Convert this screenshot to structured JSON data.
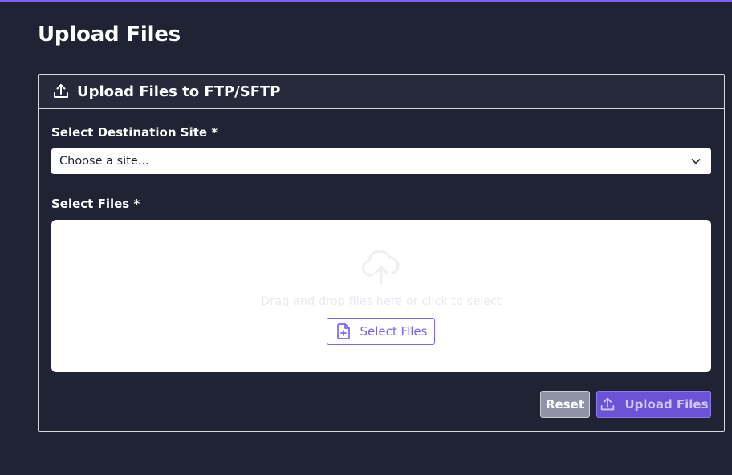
{
  "page": {
    "title": "Upload Files",
    "accent_color": "#7b61ff",
    "background_color": "#1f2333"
  },
  "card": {
    "icon": "upload-icon",
    "title": "Upload Files to FTP/SFTP"
  },
  "form": {
    "site_label": "Select Destination Site *",
    "site_select": {
      "selected": "Choose a site...",
      "icon": "chevron-down-icon"
    },
    "files_label": "Select Files *",
    "dropzone": {
      "icon": "cloud-upload-icon",
      "text": "Drag and drop files here or click to select",
      "button_label": "Select Files",
      "button_icon": "file-plus-icon"
    }
  },
  "actions": {
    "reset_label": "Reset",
    "upload_label": "Upload Files",
    "upload_icon": "upload-icon",
    "reset_color": "#8e93a7",
    "upload_color": "#6b52d6"
  }
}
